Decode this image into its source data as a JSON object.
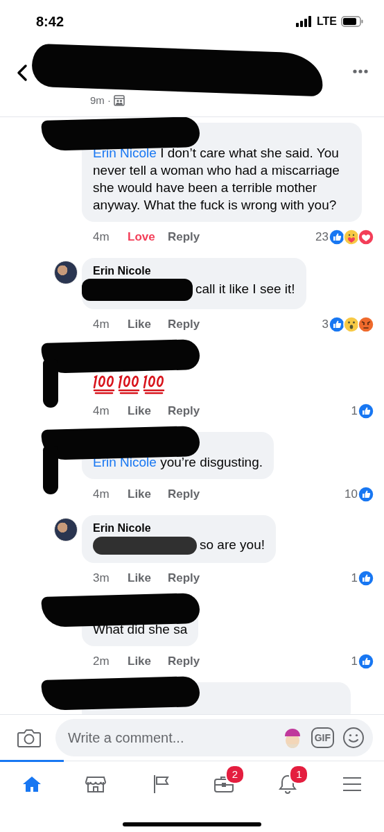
{
  "status_bar": {
    "time": "8:42",
    "network": "LTE"
  },
  "header": {
    "time": "9m ·",
    "redacted": true
  },
  "comments": [
    {
      "kind": "bubble",
      "redacted": true,
      "mention": "Erin Nicole",
      "text": " I don’t care what she said. You never tell a woman who had a miscarriage she would have been a terrible mother anyway. What the fuck is wrong with you?",
      "time": "4m",
      "action": {
        "label": "Love",
        "reacted": true,
        "kind": "love"
      },
      "reply": "Reply",
      "count": "23",
      "reactions": [
        {
          "kind": "like"
        },
        {
          "kind": "care"
        },
        {
          "kind": "love"
        }
      ]
    },
    {
      "kind": "bubble",
      "author": "Erin Nicole",
      "mention_redacted": true,
      "text": "call it like I see it!",
      "time": "4m",
      "action": {
        "label": "Like",
        "reacted": false
      },
      "reply": "Reply",
      "count": "3",
      "reactions": [
        {
          "kind": "like"
        },
        {
          "kind": "wow"
        },
        {
          "kind": "angry"
        }
      ]
    },
    {
      "kind": "emoji",
      "redacted": true,
      "emojis": [
        {
          "kind": "hundred_points"
        },
        {
          "kind": "hundred_points"
        },
        {
          "kind": "hundred_points"
        }
      ],
      "time": "4m",
      "action": {
        "label": "Like",
        "reacted": false
      },
      "reply": "Reply",
      "count": "1",
      "reactions": [
        {
          "kind": "like"
        }
      ]
    },
    {
      "kind": "bubble",
      "redacted": true,
      "mention": "Erin Nicole",
      "text": " you’re disgusting.",
      "time": "4m",
      "action": {
        "label": "Like",
        "reacted": false
      },
      "reply": "Reply",
      "count": "10",
      "reactions": [
        {
          "kind": "like"
        }
      ]
    },
    {
      "kind": "bubble",
      "author": "Erin Nicole",
      "mention_redacted": true,
      "text": "so are you!",
      "time": "3m",
      "action": {
        "label": "Like",
        "reacted": false
      },
      "reply": "Reply",
      "count": "1",
      "reactions": [
        {
          "kind": "like"
        }
      ]
    },
    {
      "kind": "bubble",
      "redacted": true,
      "text": "What did she sa",
      "time": "2m",
      "action": {
        "label": "Like",
        "reacted": false
      },
      "reply": "Reply",
      "count": "1",
      "reactions": [
        {
          "kind": "like"
        }
      ]
    },
    {
      "kind": "cut",
      "redacted": true
    }
  ],
  "composer": {
    "placeholder": "Write a comment...",
    "gif": "GIF"
  },
  "tabs": [
    {
      "kind": "home",
      "selected": true
    },
    {
      "kind": "marketplace",
      "selected": false
    },
    {
      "kind": "pages",
      "selected": false
    },
    {
      "kind": "jobs",
      "selected": false,
      "badge": "2"
    },
    {
      "kind": "notifications",
      "selected": false,
      "badge": "1"
    },
    {
      "kind": "menu",
      "selected": false
    }
  ]
}
